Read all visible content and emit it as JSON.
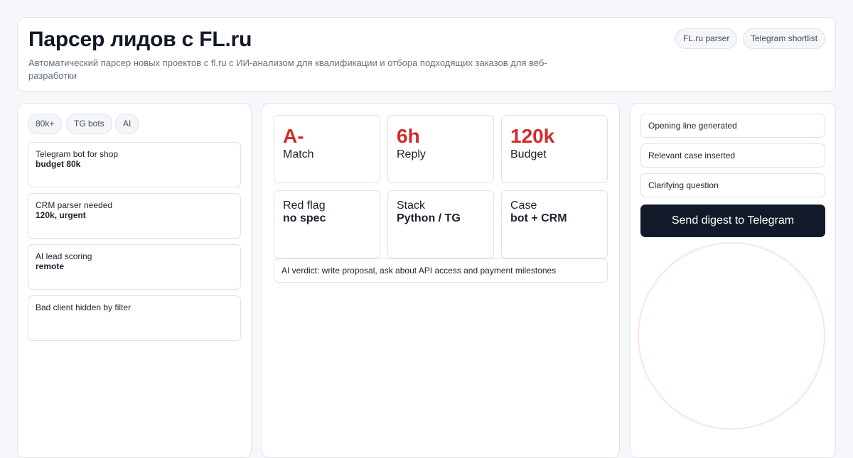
{
  "header": {
    "title": "Парсер лидов с FL.ru",
    "subtitle": "Автоматический парсер новых проектов с fl.ru с ИИ-анализом для квалификации и отбора подходящих заказов для веб-разработки",
    "chips": [
      "FL.ru parser",
      "Telegram shortlist"
    ]
  },
  "filters": [
    "80k+",
    "TG bots",
    "AI"
  ],
  "leads": [
    {
      "title": "Telegram bot for shop",
      "detail": "budget 80k"
    },
    {
      "title": "CRM parser needed",
      "detail": "120k, urgent"
    },
    {
      "title": "AI lead scoring",
      "detail": "remote"
    },
    {
      "title": "Bad client hidden by filter",
      "detail": ""
    }
  ],
  "metrics": [
    {
      "value": "A-",
      "label": "Match"
    },
    {
      "value": "6h",
      "label": "Reply"
    },
    {
      "value": "120k",
      "label": "Budget"
    }
  ],
  "facts": [
    {
      "label": "Red flag",
      "value": "no spec"
    },
    {
      "label": "Stack",
      "value": "Python / TG"
    },
    {
      "label": "Case",
      "value": "bot + CRM"
    }
  ],
  "verdict": "AI verdict: write proposal, ask about API access and payment milestones",
  "steps": [
    "Opening line generated",
    "Relevant case inserted",
    "Clarifying question"
  ],
  "send_button": "Send digest to Telegram",
  "colors": {
    "accent": "#d42a2a",
    "button": "#121a2a",
    "ring": "#fbe3e5"
  }
}
